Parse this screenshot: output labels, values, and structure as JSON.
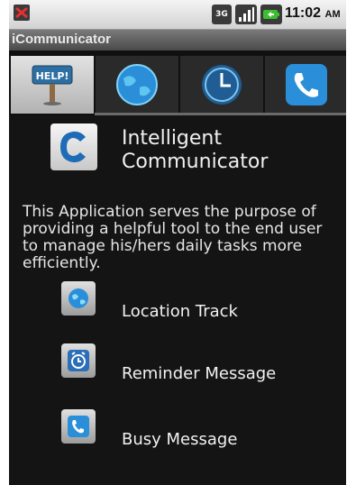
{
  "status_bar": {
    "time": "11:02",
    "ampm": "AM",
    "network": "3G",
    "icons": [
      "missed-call-icon",
      "3g-icon",
      "signal-icon",
      "battery-icon"
    ]
  },
  "app": {
    "title": "iCommunicator"
  },
  "tabs": [
    {
      "name": "help",
      "icon": "help-sign-icon",
      "active": true
    },
    {
      "name": "location",
      "icon": "globe-icon",
      "active": false
    },
    {
      "name": "reminder",
      "icon": "clock-icon",
      "active": false
    },
    {
      "name": "call",
      "icon": "phone-icon",
      "active": false
    }
  ],
  "header": {
    "logo_icon": "app-logo-icon",
    "name_line1": "Intelligent",
    "name_line2": "Communicator"
  },
  "description": "This Application serves the purpose of providing a helpful tool to the end user to manage his/hers daily tasks more efficiently.",
  "features": [
    {
      "label": "Location Track",
      "icon": "globe-icon"
    },
    {
      "label": "Reminder Message",
      "icon": "alarm-clock-icon"
    },
    {
      "label": "Busy Message",
      "icon": "phone-icon"
    }
  ],
  "colors": {
    "background": "#141414",
    "accent_blue": "#2a8fd8",
    "text": "#f0f0f0"
  }
}
